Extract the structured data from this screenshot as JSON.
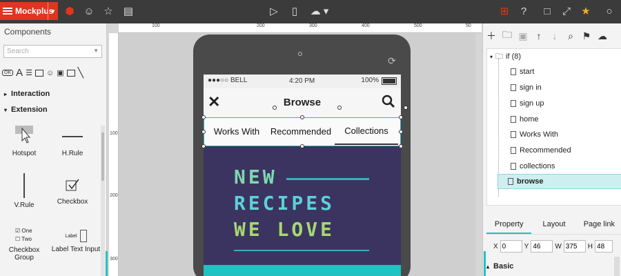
{
  "app": {
    "name": "Mockplus"
  },
  "toolbar": {
    "icons": [
      "box-icon",
      "smiley-icon",
      "star-icon",
      "window-icon",
      "play-icon",
      "phone-icon",
      "upload-icon",
      "grid-icon",
      "help-icon",
      "square-icon",
      "fullscreen-icon",
      "badge-icon"
    ]
  },
  "left_panel": {
    "title": "Components",
    "search_placeholder": "Search",
    "categories": [
      {
        "label": "Interaction",
        "expanded": false
      },
      {
        "label": "Extension",
        "expanded": true
      }
    ],
    "components": [
      {
        "label": "Hotspot"
      },
      {
        "label": "H.Rule"
      },
      {
        "label": "V.Rule"
      },
      {
        "label": "Checkbox"
      },
      {
        "label": "Checkbox Group",
        "one": "One",
        "two": "Two"
      },
      {
        "label": "Label Text Input",
        "preview": "Label"
      }
    ]
  },
  "ruler": {
    "h_ticks": [
      "100",
      "100",
      "200",
      "300",
      "400",
      "500"
    ],
    "v_ticks": [
      "100",
      "200",
      "300"
    ]
  },
  "phone": {
    "status": {
      "carrier": "●●●○○ BELL",
      "time": "4:20 PM",
      "battery": "100%",
      "battery_level": 1.0
    },
    "nav_title": "Browse",
    "tabs": [
      {
        "label": "Works With",
        "active": false
      },
      {
        "label": "Recommended",
        "active": false
      },
      {
        "label": "Collections",
        "active": true
      }
    ],
    "hero": {
      "line1": "NEW",
      "line2": "RECIPES",
      "line3": "WE LOVE"
    }
  },
  "right_panel": {
    "tree_root": "if (8)",
    "pages": [
      "start",
      "sign in",
      "sign up",
      "home",
      "Works With",
      "Recommended",
      "collections",
      "browse"
    ],
    "active_page": "browse",
    "tabs": [
      {
        "label": "Property",
        "active": true
      },
      {
        "label": "Layout",
        "active": false
      },
      {
        "label": "Page link",
        "active": false
      }
    ],
    "position": {
      "x": "0",
      "y": "46",
      "w": "375",
      "h": "48"
    },
    "section": "Basic"
  },
  "colors": {
    "brand": "#e0351e",
    "accent": "#21c1c1",
    "hero_bg": "#3b3461",
    "toolbar": "#3b3b3b"
  }
}
